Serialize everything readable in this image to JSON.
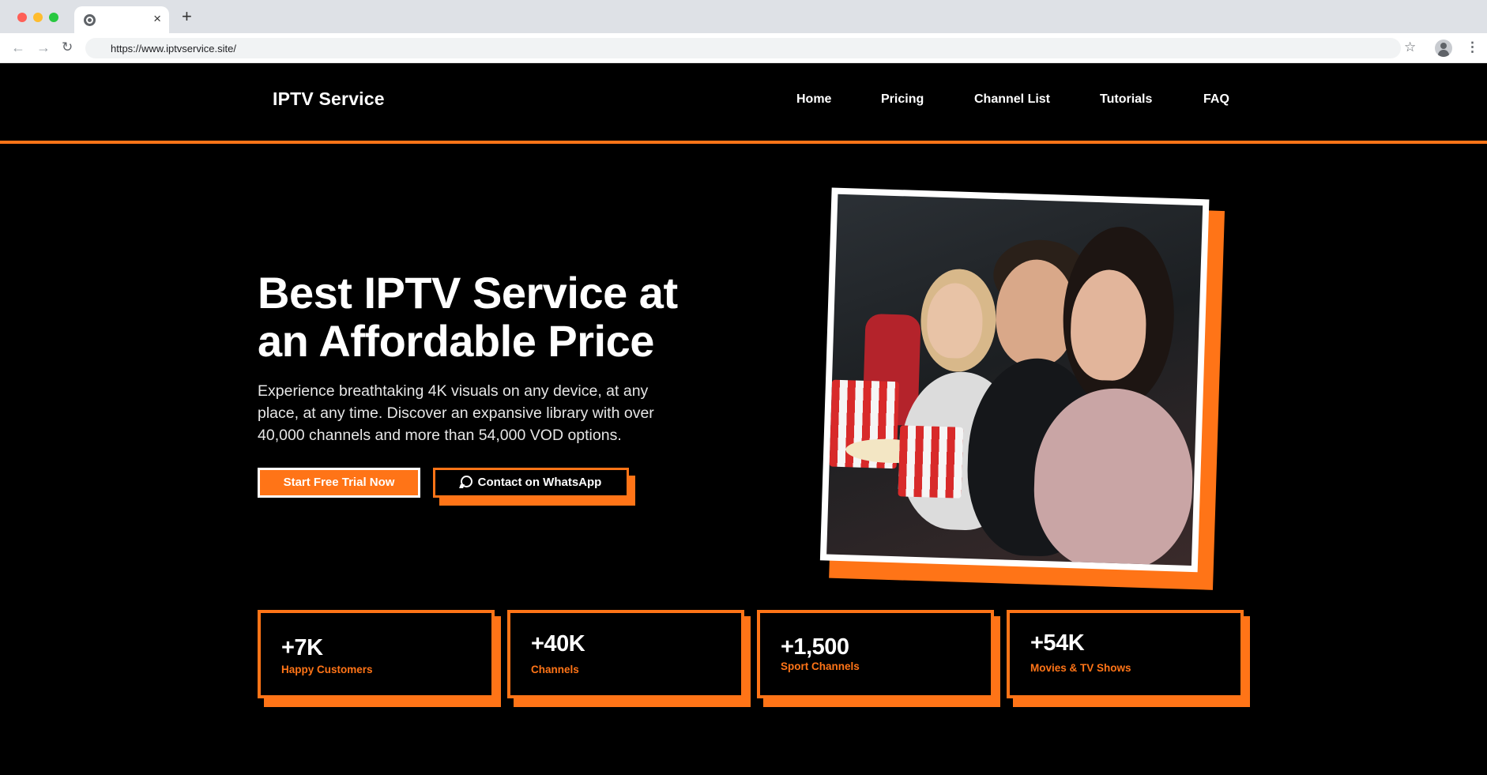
{
  "browser": {
    "url": "https://www.iptvservice.site/",
    "tab_close": "×",
    "new_tab": "+",
    "back": "←",
    "forward": "→",
    "reload": "↻",
    "star": "☆",
    "menu": "⋮"
  },
  "header": {
    "logo": "IPTV Service",
    "nav": [
      "Home",
      "Pricing",
      "Channel List",
      "Tutorials",
      "FAQ"
    ]
  },
  "hero": {
    "title_line1": "Best IPTV Service at",
    "title_line2": "an Affordable Price",
    "desc_line1": "Experience breathtaking 4K visuals on any device, at any",
    "desc_line2": "place, at any time. Discover an expansive library with over",
    "desc_line3": "40,000 channels and more than 54,000 VOD options.",
    "cta_primary": "Start Free Trial Now",
    "cta_secondary": "Contact on WhatsApp"
  },
  "stats": [
    {
      "value": "+7K",
      "label": "Happy Customers"
    },
    {
      "value": "+40K",
      "label": "Channels"
    },
    {
      "value": "+1,500",
      "label": "Sport Channels"
    },
    {
      "value": "+54K",
      "label": "Movies & TV Shows"
    }
  ],
  "colors": {
    "accent": "#ff7417",
    "background": "#000000",
    "text": "#ffffff"
  }
}
